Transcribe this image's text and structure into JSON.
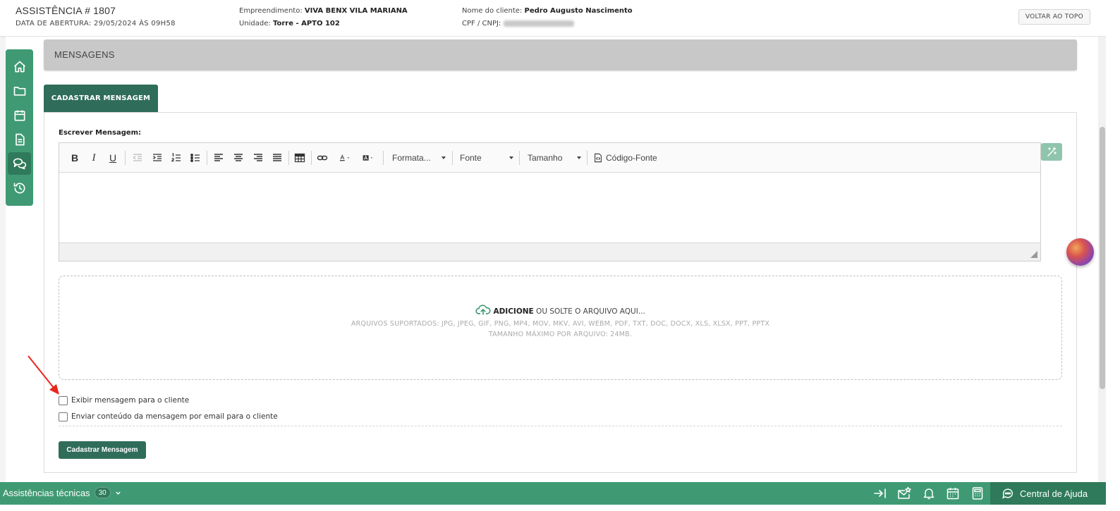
{
  "header": {
    "title": "ASSISTÊNCIA # 1807",
    "opening_date": "DATA DE ABERTURA: 29/05/2024 ÀS 09H58",
    "empreendimento_label": "Empreendimento:",
    "empreendimento_value": "VIVA BENX VILA MARIANA",
    "unidade_label": "Unidade:",
    "unidade_value": "Torre - APTO 102",
    "cliente_label": "Nome do cliente:",
    "cliente_value": "Pedro Augusto Nascimento",
    "cpf_label": "CPF / CNPJ:",
    "back_to_top": "VOLTAR AO TOPO"
  },
  "sidebar": {
    "items": [
      {
        "icon": "home-icon"
      },
      {
        "icon": "folder-icon"
      },
      {
        "icon": "calendar-icon"
      },
      {
        "icon": "document-icon"
      },
      {
        "icon": "chat-icon",
        "active": true
      },
      {
        "icon": "history-icon"
      }
    ]
  },
  "section": {
    "title": "MENSAGENS"
  },
  "tab": {
    "label": "CADASTRAR MENSAGEM"
  },
  "form": {
    "write_label": "Escrever Mensagem:",
    "toolbar": {
      "format_label": "Formata...",
      "font_label": "Fonte",
      "size_label": "Tamanho",
      "source_label": "Código-Fonte"
    },
    "dropzone": {
      "add_strong": "ADICIONE",
      "add_rest": " OU SOLTE O ARQUIVO AQUI...",
      "supported": "ARQUIVOS SUPORTADOS: JPG, JPEG, GIF, PNG, MP4, MOV, MKV, AVI, WEBM, PDF, TXT, DOC, DOCX, XLS, XLSX, PPT, PPTX",
      "max_size": "TAMANHO MÁXIMO POR ARQUIVO: 24MB."
    },
    "checkbox_show_client": "Exibir mensagem para o cliente",
    "checkbox_email_client": "Enviar conteúdo da mensagem por email para o cliente",
    "submit_label": "Cadastrar Mensagem"
  },
  "bottom_bar": {
    "label": "Assistências técnicas",
    "count": "30",
    "help_label": "Central de Ajuda"
  },
  "colors": {
    "primary_green": "#3f9a73",
    "dark_green": "#2f6d5a",
    "annotation_red": "#e8261d"
  }
}
